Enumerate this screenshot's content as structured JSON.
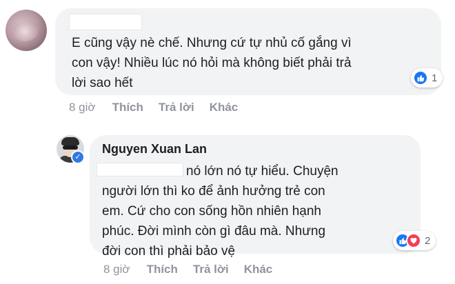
{
  "comments": [
    {
      "author": "",
      "text_lines": [
        "E cũng vậy nè chế. Nhưng cứ tự nhủ cố gắng vì",
        "con vậy! Nhiều lúc nó hỏi mà không biết phải trả",
        "lời sao hết"
      ],
      "reactions": {
        "icons": [
          "like-icon"
        ],
        "count": "1"
      },
      "time": "8 giờ",
      "actions": [
        "Thích",
        "Trả lời",
        "Khác"
      ]
    },
    {
      "author": "Nguyen Xuan Lan",
      "verified": true,
      "text_lines": [
        "nó lớn nó tự hiểu. Chuyện",
        "người lớn thì ko để ảnh hưởng trẻ con",
        "em. Cứ cho con sống hồn nhiên hạnh",
        "phúc. Đời mình còn gì đâu mà. Nhưng",
        "đời con thì phải bảo vệ"
      ],
      "reactions": {
        "icons": [
          "like-icon",
          "love-icon"
        ],
        "count": "2"
      },
      "time": "8 giờ",
      "actions": [
        "Thích",
        "Trả lời",
        "Khác"
      ]
    }
  ],
  "colors": {
    "bubble": "#f2f3f5",
    "meta_text": "#90949c",
    "like": "#1877f2",
    "love": "#f33e58",
    "verified": "#3578e5"
  }
}
